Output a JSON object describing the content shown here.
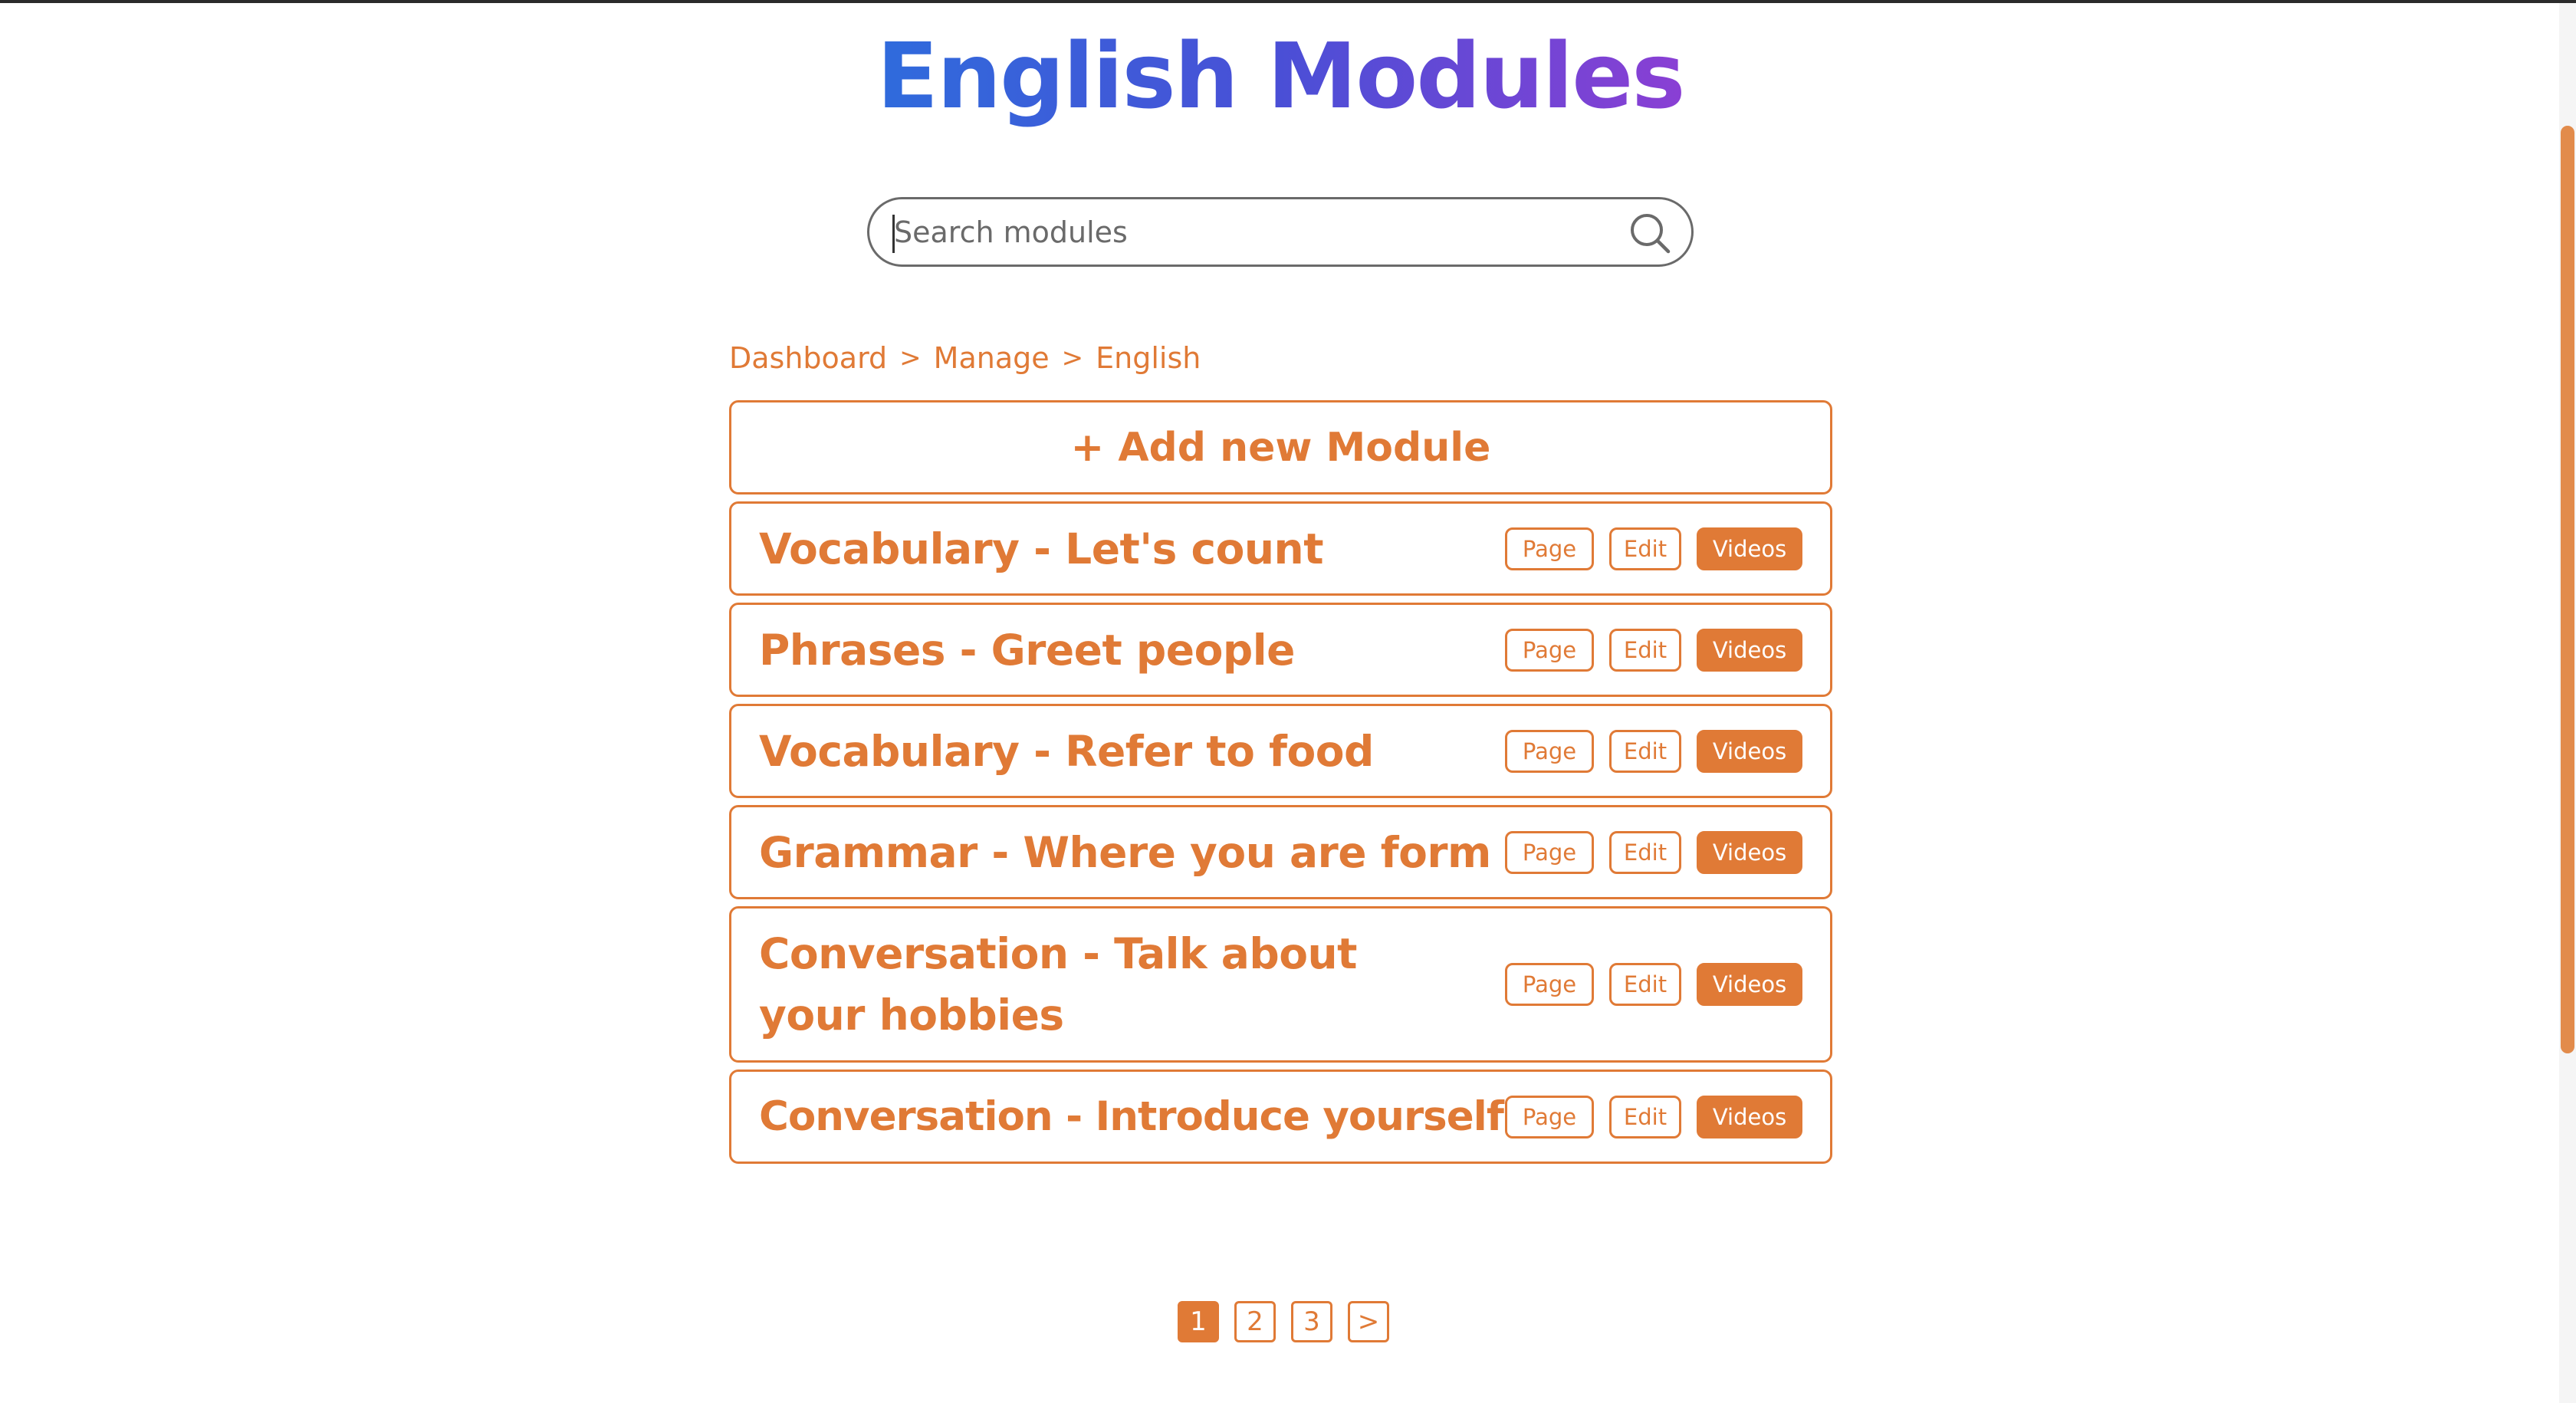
{
  "header": {
    "title": "English Modules"
  },
  "search": {
    "placeholder": "Search modules",
    "icon": "search-icon"
  },
  "breadcrumb": {
    "items": [
      "Dashboard",
      "Manage",
      "English"
    ],
    "separator": ">"
  },
  "add_module": {
    "label": "+ Add new Module"
  },
  "modules": [
    {
      "name": "Vocabulary - Let's count",
      "page": "Page",
      "edit": "Edit",
      "videos": "Videos"
    },
    {
      "name": "Phrases - Greet people",
      "page": "Page",
      "edit": "Edit",
      "videos": "Videos"
    },
    {
      "name": "Vocabulary - Refer to food",
      "page": "Page",
      "edit": "Edit",
      "videos": "Videos"
    },
    {
      "name": "Grammar - Where you are form",
      "page": "Page",
      "edit": "Edit",
      "videos": "Videos"
    },
    {
      "name": "Conversation - Talk about your hobbies",
      "page": "Page",
      "edit": "Edit",
      "videos": "Videos"
    },
    {
      "name": "Conversation - Introduce yourself",
      "page": "Page",
      "edit": "Edit",
      "videos": "Videos"
    }
  ],
  "pagination": {
    "pages": [
      "1",
      "2",
      "3"
    ],
    "next": ">",
    "current": "1"
  },
  "colors": {
    "accent": "#e07a36",
    "title_gradient_start": "#2f6bdc",
    "title_gradient_end": "#8a3fd4"
  }
}
